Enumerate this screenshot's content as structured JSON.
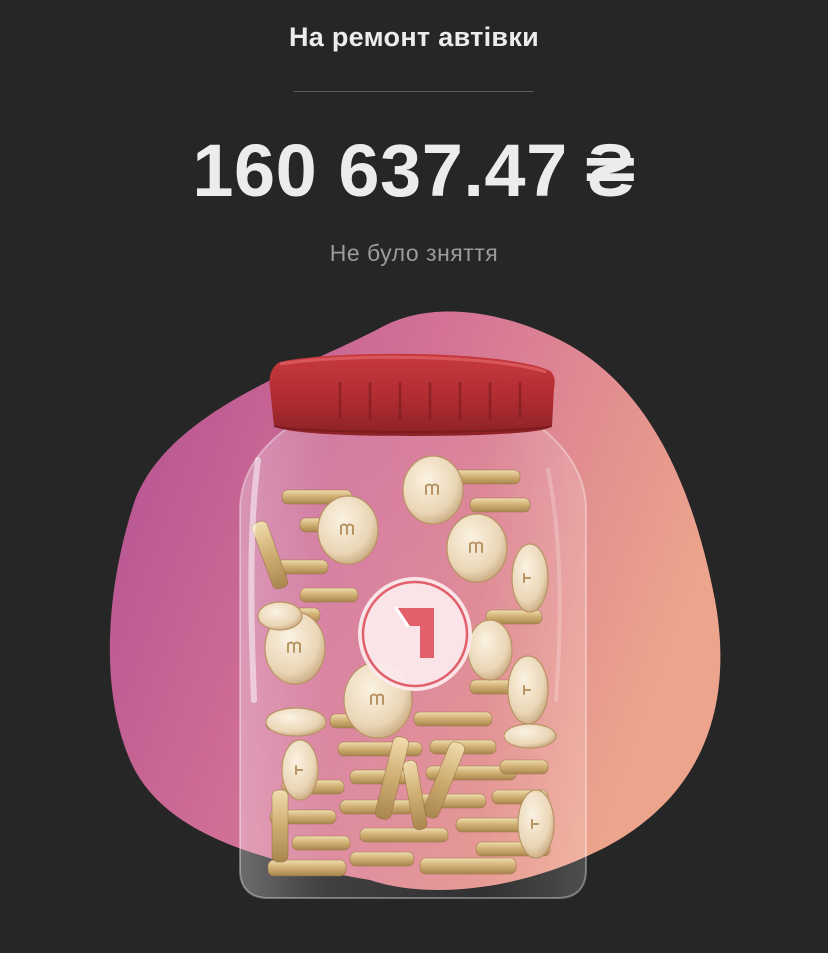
{
  "jar": {
    "title": "На ремонт автівки",
    "balance": "160 637.47",
    "currency_symbol": "₴",
    "withdrawal_status": "Не було зняття"
  },
  "icons": {
    "jar_logo": "monobank-arrow-icon",
    "illustration": "coin-jar-illustration"
  },
  "colors": {
    "background": "#262626",
    "blob_gradient_start": "#b24f92",
    "blob_gradient_end": "#eda48c",
    "lid": "#b42f34",
    "logo_accent": "#e2606a"
  }
}
